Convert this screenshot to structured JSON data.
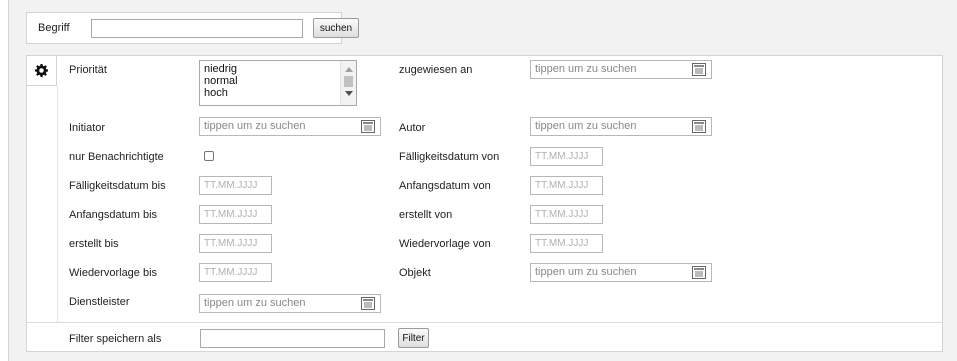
{
  "search": {
    "term_label": "Begriff",
    "term_value": "",
    "submit_label": "suchen"
  },
  "filter": {
    "settings_icon": "gear-icon",
    "search_field_icon": "list-picker-icon",
    "priority": {
      "label": "Priorität",
      "options": [
        "niedrig",
        "normal",
        "hoch"
      ],
      "partially_visible_option": ""
    },
    "assigned_to": {
      "label": "zugewiesen an",
      "placeholder": "tippen um zu suchen"
    },
    "initiator": {
      "label": "Initiator",
      "placeholder": "tippen um zu suchen"
    },
    "author": {
      "label": "Autor",
      "placeholder": "tippen um zu suchen"
    },
    "notified_only": {
      "label": "nur Benachrichtigte",
      "checked": false
    },
    "due_from": {
      "label": "Fälligkeitsdatum von",
      "placeholder": "TT.MM.JJJJ"
    },
    "due_to": {
      "label": "Fälligkeitsdatum bis",
      "placeholder": "TT.MM.JJJJ"
    },
    "start_from": {
      "label": "Anfangsdatum von",
      "placeholder": "TT.MM.JJJJ"
    },
    "start_to": {
      "label": "Anfangsdatum bis",
      "placeholder": "TT.MM.JJJJ"
    },
    "created_from": {
      "label": "erstellt von",
      "placeholder": "TT.MM.JJJJ"
    },
    "created_to": {
      "label": "erstellt bis",
      "placeholder": "TT.MM.JJJJ"
    },
    "resubmit_from": {
      "label": "Wiedervorlage von",
      "placeholder": "TT.MM.JJJJ"
    },
    "resubmit_to": {
      "label": "Wiedervorlage bis",
      "placeholder": "TT.MM.JJJJ"
    },
    "object": {
      "label": "Objekt",
      "placeholder": "tippen um zu suchen"
    },
    "service_provider": {
      "label": "Dienstleister",
      "placeholder": "tippen um zu suchen"
    }
  },
  "save_filter": {
    "label": "Filter speichern als",
    "value": "",
    "button_label": "Filter"
  }
}
